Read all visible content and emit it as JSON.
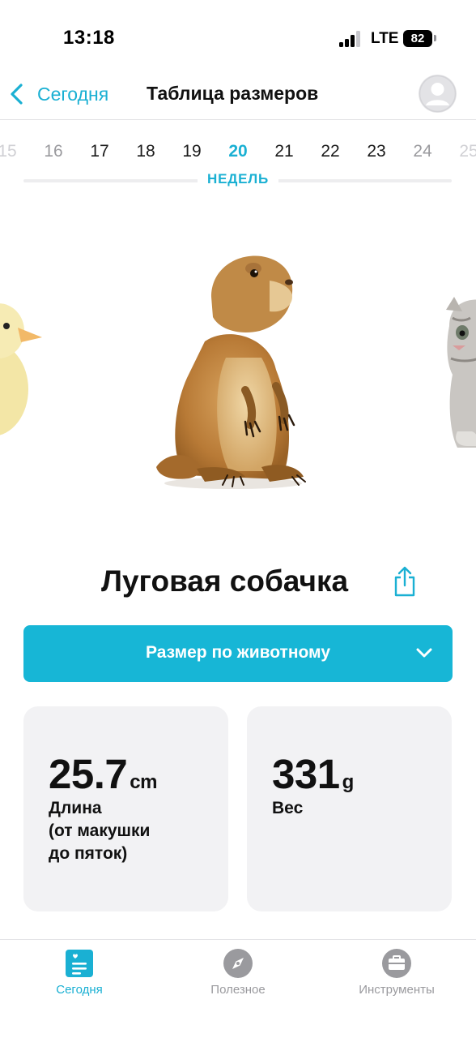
{
  "status_bar": {
    "time": "13:18",
    "network": "LTE",
    "battery": "82"
  },
  "nav": {
    "back_label": "Сегодня",
    "title": "Таблица размеров",
    "back_icon": "chevron-left-icon",
    "avatar_icon": "user-avatar-icon"
  },
  "weeks": {
    "items": [
      "15",
      "16",
      "17",
      "18",
      "19",
      "20",
      "21",
      "22",
      "23",
      "24",
      "25"
    ],
    "selected": "20",
    "label": "НЕДЕЛЬ"
  },
  "carousel": {
    "items": [
      "duckling",
      "prairie-dog",
      "kitten"
    ],
    "current": "prairie-dog"
  },
  "animal": {
    "name": "Луговая собачка",
    "share_icon": "share-icon"
  },
  "size_selector": {
    "label": "Размер по животному",
    "icon": "chevron-down-icon"
  },
  "measurements": {
    "length": {
      "value": "25.7",
      "unit": "cm",
      "label_lines": [
        "Длина",
        "(от макушки",
        "до пяток)"
      ]
    },
    "weight": {
      "value": "331",
      "unit": "g",
      "label": "Вес"
    }
  },
  "tab_bar": {
    "tabs": [
      {
        "label": "Сегодня",
        "icon": "calendar-today-icon",
        "active": true
      },
      {
        "label": "Полезное",
        "icon": "compass-icon",
        "active": false
      },
      {
        "label": "Инструменты",
        "icon": "briefcase-icon",
        "active": false
      }
    ]
  },
  "colors": {
    "accent": "#1ab0d3",
    "dropdown": "#17b6d6",
    "card_bg": "#f2f2f4",
    "inactive": "#9a9a9e"
  }
}
